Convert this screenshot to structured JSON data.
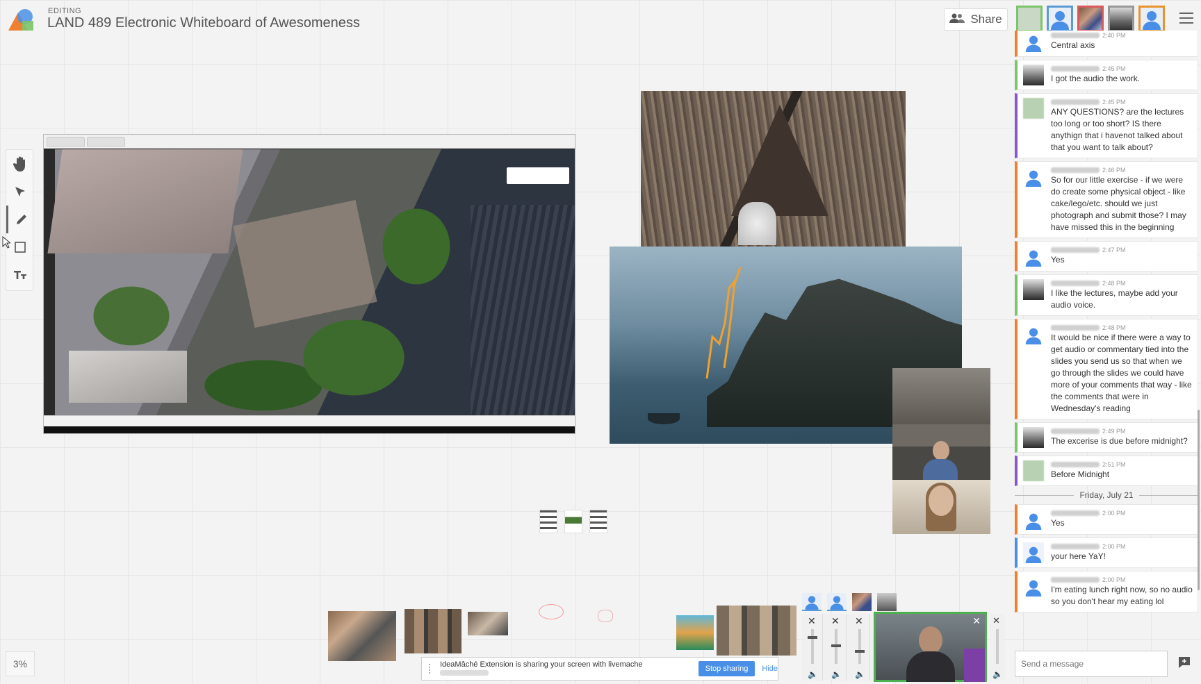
{
  "header": {
    "editing_label": "EDITING",
    "board_title": "LAND 489 Electronic Whiteboard of Awesomeness",
    "share_label": "Share"
  },
  "toolbar": {
    "tools": [
      "hand-icon",
      "select-arrow-icon",
      "pencil-icon",
      "rectangle-icon",
      "text-icon"
    ],
    "zoom_level": "3%"
  },
  "share_bar": {
    "message": "IdeaMâché Extension is sharing your screen with livemache",
    "stop_label": "Stop sharing",
    "hide_label": "Hide"
  },
  "chat": {
    "messages": [
      {
        "time": "2:40 PM",
        "text": "Central axis",
        "color": "orange",
        "avatar": "user"
      },
      {
        "time": "2:45 PM",
        "text": "I got the audio the work.",
        "color": "green",
        "avatar": "photo"
      },
      {
        "time": "2:45 PM",
        "text": "ANY QUESTIONS? are the lectures too long or too short? IS there anythign that i havenot talked about that you want to talk about?",
        "color": "purple",
        "avatar": "green"
      },
      {
        "time": "2:46 PM",
        "text": "So for our little exercise - if we were do create some physical object - like cake/lego/etc. should we just photograph and submit those? I may have missed this in the beginning",
        "color": "orange",
        "avatar": "user"
      },
      {
        "time": "2:47 PM",
        "text": "Yes",
        "color": "orange",
        "avatar": "user"
      },
      {
        "time": "2:48 PM",
        "text": "I like the lectures, maybe add your audio voice.",
        "color": "green",
        "avatar": "photo"
      },
      {
        "time": "2:48 PM",
        "text": "It would be nice if there were a way to get audio or commentary tied into the slides you send us so that when we go through the slides we could have more of your comments that way - like the comments that were in Wednesday's reading",
        "color": "orange",
        "avatar": "user"
      },
      {
        "time": "2:49 PM",
        "text": "The excerise is due before midnight?",
        "color": "green",
        "avatar": "photo"
      },
      {
        "time": "2:51 PM",
        "text": "Before Midnight",
        "color": "purple",
        "avatar": "green"
      }
    ],
    "day_divider": "Friday, July 21",
    "messages_after": [
      {
        "time": "2:00 PM",
        "text": "Yes",
        "color": "orange",
        "avatar": "user"
      },
      {
        "time": "2:00 PM",
        "text": "your here YaY!",
        "color": "blue",
        "avatar": "blueuser"
      },
      {
        "time": "2:00 PM",
        "text": "I'm eating lunch right now, so no audio so you don't hear my eating lol",
        "color": "orange",
        "avatar": "user"
      }
    ],
    "input_placeholder": "Send a message"
  },
  "colors": {
    "accent_green": "#7cc46a",
    "accent_orange": "#f08030",
    "accent_purple": "#8a56c9",
    "accent_blue": "#4a8fe7"
  }
}
